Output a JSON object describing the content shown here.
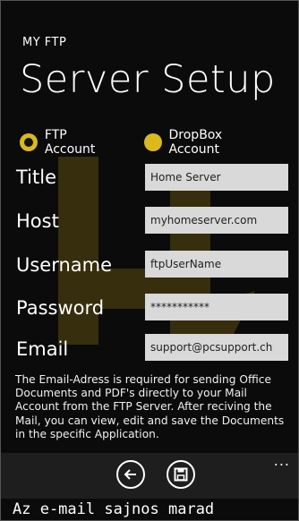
{
  "app": {
    "title": "MY FTP",
    "page_title": "Server Setup"
  },
  "account_type": {
    "options": [
      {
        "label": "FTP Account",
        "selected": true
      },
      {
        "label": "DropBox Account",
        "selected": false
      }
    ]
  },
  "form": {
    "title": {
      "label": "Title",
      "value": "Home Server"
    },
    "host": {
      "label": "Host",
      "value": "myhomeserver.com"
    },
    "username": {
      "label": "Username",
      "value": "ftpUserName"
    },
    "password": {
      "label": "Password",
      "value": "***********"
    },
    "email": {
      "label": "Email",
      "value": "support@pcsupport.ch"
    }
  },
  "info_text": "The Email-Adress is required for sending Office Documents and PDF's directly to your Mail Account from the FTP Server. After reciving the Mail, you can view, edit and save the Documents in the specific Application.",
  "appbar": {
    "icons": [
      "back-icon",
      "save-icon"
    ],
    "more": "..."
  },
  "caption": "Az e-mail sajnos marad",
  "colors": {
    "accent": "#d9b91c",
    "background": "#0b0b0b",
    "field": "#d9d9d9",
    "appbar": "#1e1e1e"
  }
}
